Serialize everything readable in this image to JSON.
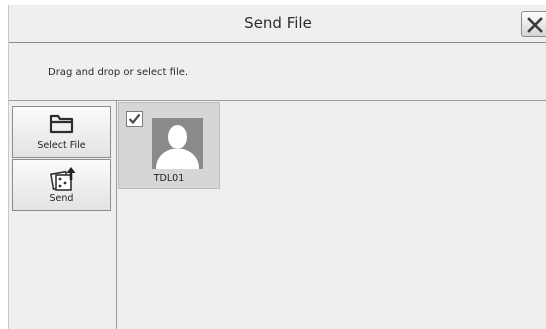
{
  "window": {
    "title": "Send File",
    "close_icon": "close-icon"
  },
  "instruction": "Drag and drop or select file.",
  "sidebar": {
    "buttons": [
      {
        "label": "Select File",
        "icon": "folder-icon"
      },
      {
        "label": "Send",
        "icon": "send-photos-icon"
      }
    ]
  },
  "files": [
    {
      "name": "TDL01",
      "checked": true,
      "icon": "user-avatar-icon"
    }
  ]
}
